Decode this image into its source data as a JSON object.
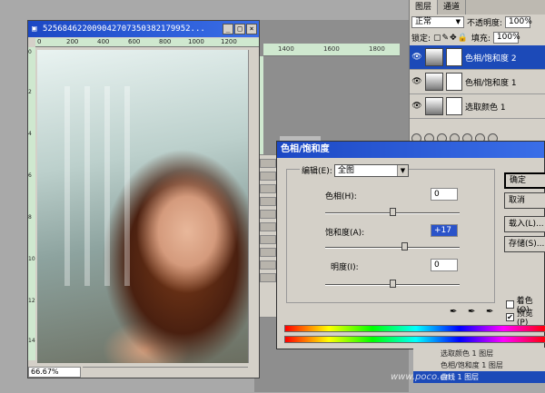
{
  "document": {
    "title": "5256846220090427073503821799​52...",
    "ruler_h": [
      "0",
      "200",
      "400",
      "600",
      "800",
      "1000",
      "1200"
    ],
    "ruler_v": [
      "0",
      "2",
      "4",
      "6",
      "8",
      "10",
      "12",
      "14"
    ],
    "zoom": "66.67%"
  },
  "background_window": {
    "ruler": [
      "1400",
      "1600",
      "1800"
    ]
  },
  "layers_panel": {
    "tabs": [
      "图层",
      "通道"
    ],
    "blend_mode": "正常",
    "opacity_label": "不透明度:",
    "opacity_value": "100%",
    "lock_label": "锁定:",
    "fill_label": "填充:",
    "fill_value": "100%",
    "layers": [
      {
        "name": "色相/饱和度 2",
        "active": true
      },
      {
        "name": "色相/饱和度 1",
        "active": false
      },
      {
        "name": "选取颜色 1",
        "active": false
      }
    ]
  },
  "dialog": {
    "title": "色相/饱和度",
    "edit_label": "编辑(E):",
    "edit_value": "全图",
    "hue_label": "色相(H):",
    "hue_value": "0",
    "saturation_label": "饱和度(A):",
    "saturation_value": "+17",
    "lightness_label": "明度(I):",
    "lightness_value": "0",
    "buttons": {
      "ok": "确定",
      "cancel": "取消",
      "load": "载入(L)...",
      "save": "存储(S)..."
    },
    "colorize_label": "着色(O)",
    "preview_label": "预览(P)",
    "colorize_checked": false,
    "preview_checked": true
  },
  "bottom_layers": [
    "选取颜色 1 图层",
    "色相/饱和度 1 图层",
    "曲线 1 图层"
  ],
  "watermark": "www.poco.cn",
  "colors": {
    "title_blue": "#1c48c4",
    "ruler_green": "#cfe8cf",
    "selection_blue": "#1c4ab8"
  }
}
